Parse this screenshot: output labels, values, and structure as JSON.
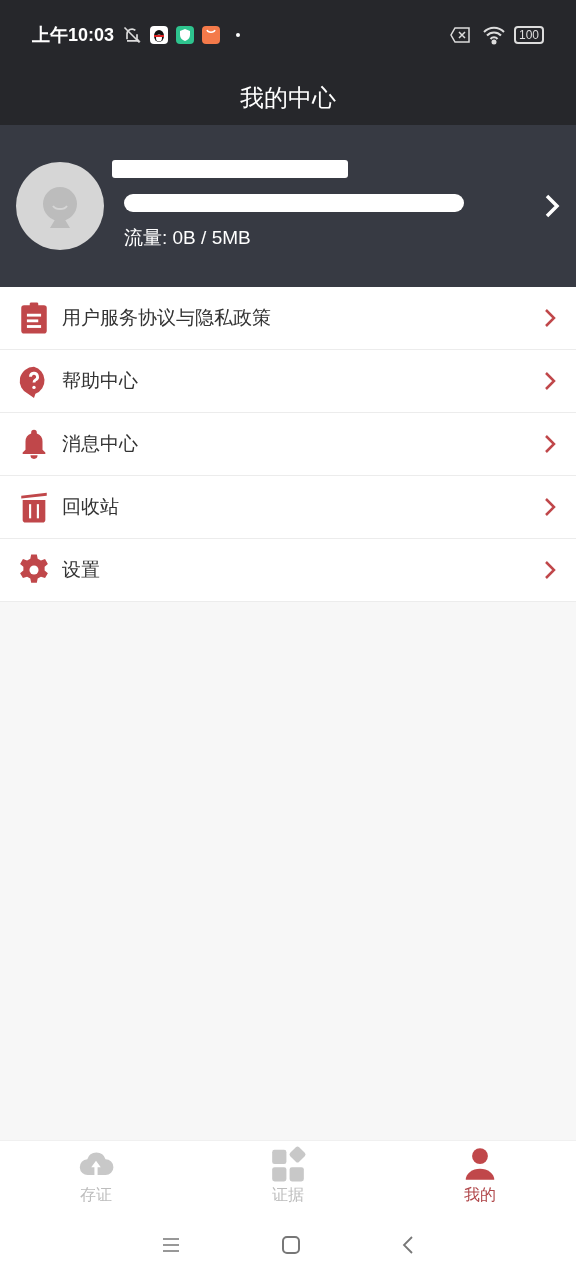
{
  "status_bar": {
    "time": "上午10:03",
    "battery": "100"
  },
  "header": {
    "title": "我的中心"
  },
  "profile": {
    "quota": "流量: 0B / 5MB"
  },
  "menu": [
    {
      "kind": "clipboard",
      "label": "用户服务协议与隐私政策"
    },
    {
      "kind": "help",
      "label": "帮助中心"
    },
    {
      "kind": "bell",
      "label": "消息中心"
    },
    {
      "kind": "trash",
      "label": "回收站"
    },
    {
      "kind": "gear",
      "label": "设置"
    }
  ],
  "tabs": [
    {
      "kind": "cloud",
      "label": "存证",
      "selected": false
    },
    {
      "kind": "grid",
      "label": "证据",
      "selected": false
    },
    {
      "kind": "person",
      "label": "我的",
      "selected": true
    }
  ]
}
